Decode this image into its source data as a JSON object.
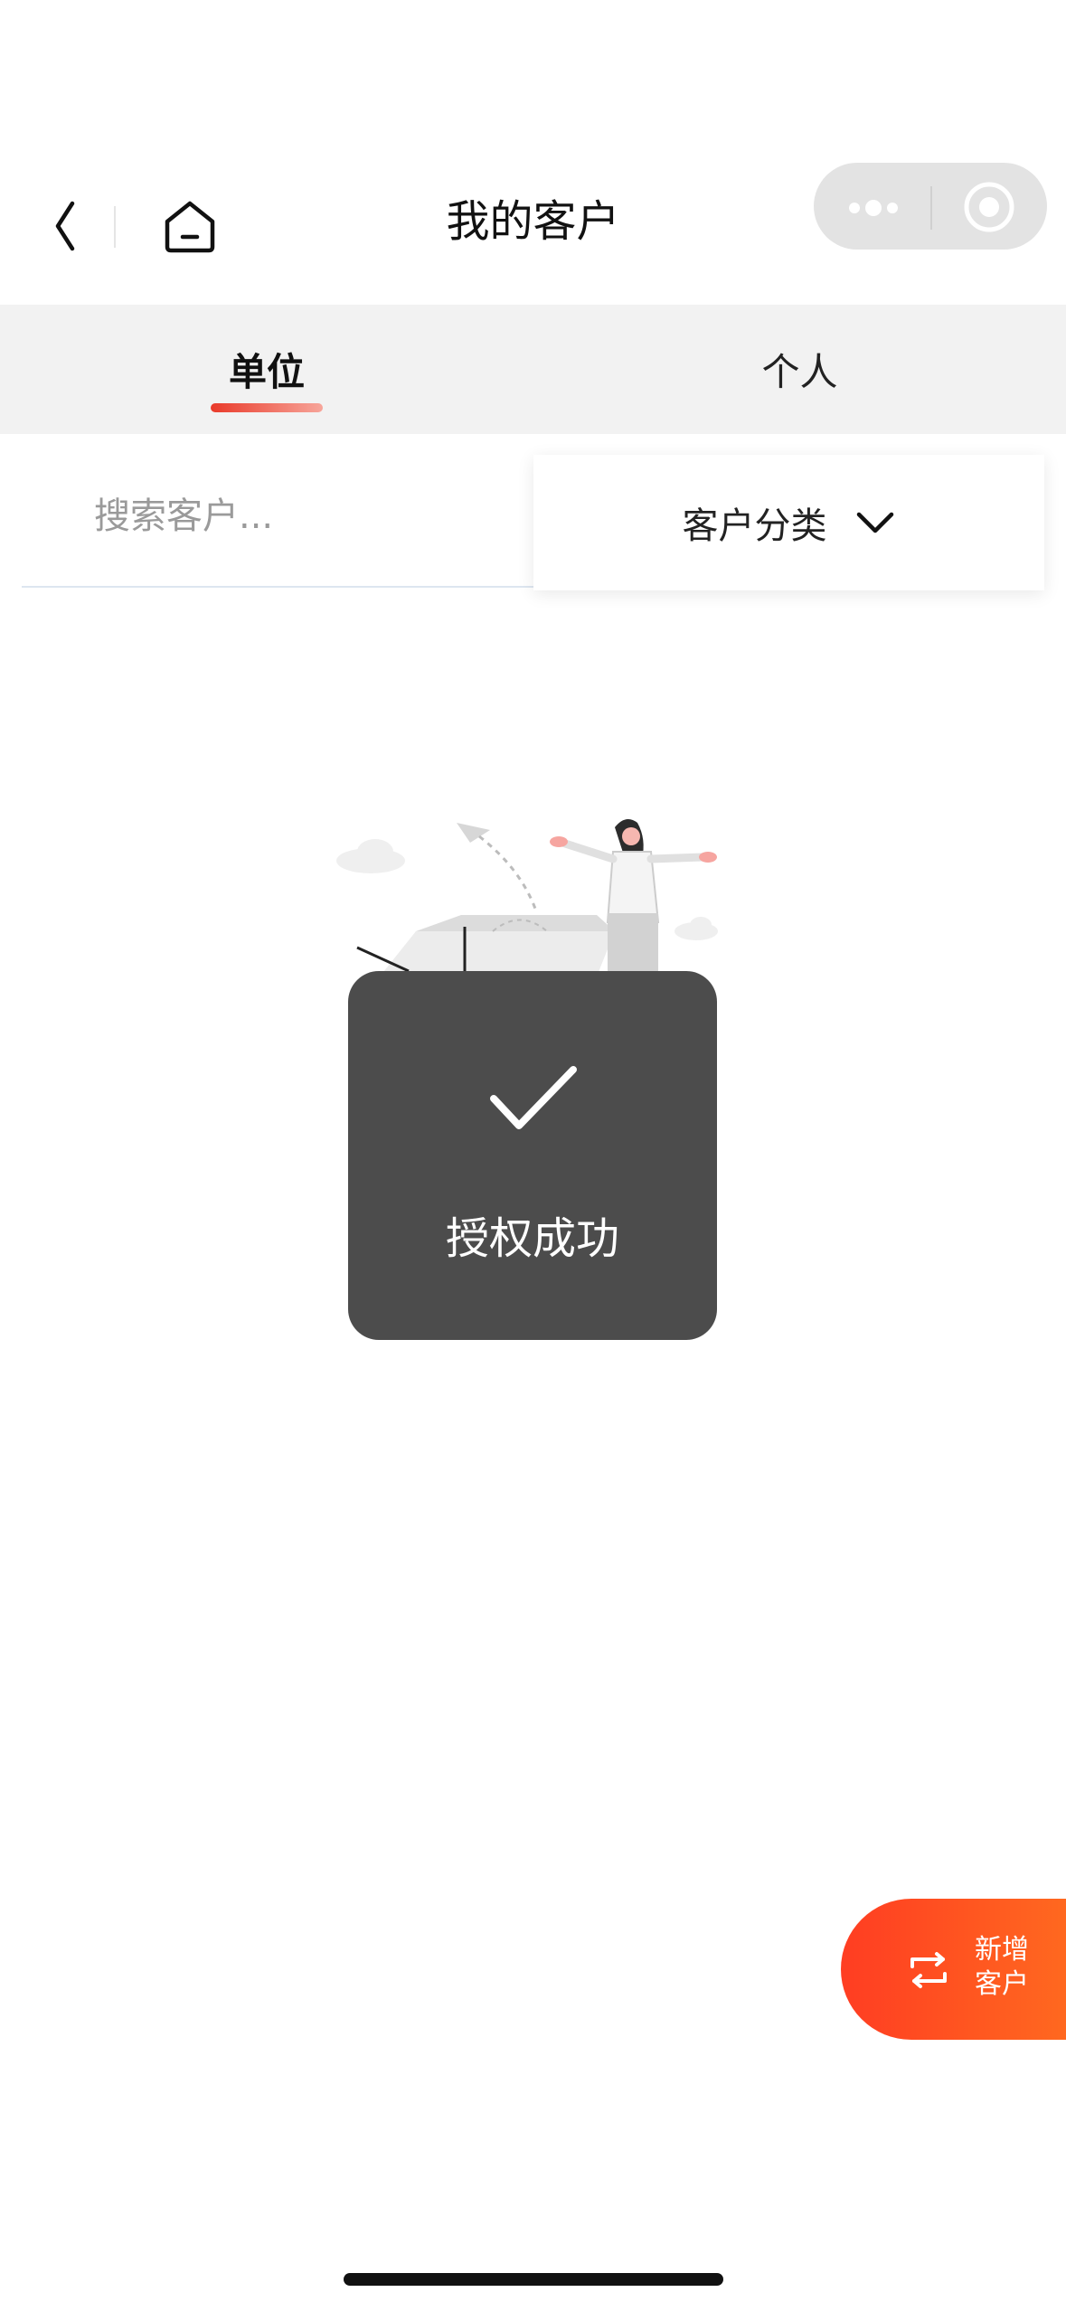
{
  "header": {
    "title": "我的客户",
    "back_icon": "chevron-left-icon",
    "home_icon": "home-icon",
    "capsule_more_icon": "more-dots-icon",
    "capsule_close_icon": "target-close-icon"
  },
  "tabs": [
    {
      "label": "单位",
      "active": true
    },
    {
      "label": "个人",
      "active": false
    }
  ],
  "search": {
    "placeholder": "搜索客户...",
    "value": ""
  },
  "filter": {
    "label": "客户分类",
    "icon": "chevron-down-icon"
  },
  "empty_state": {
    "illustration": "woman-with-open-box-illustration"
  },
  "toast": {
    "icon": "check-icon",
    "message": "授权成功"
  },
  "fab": {
    "icon": "swap-arrows-icon",
    "line1": "新增",
    "line2": "客户"
  },
  "colors": {
    "accent": "#e93a2a",
    "fab_start": "#ff3d22",
    "fab_end": "#ff6a1f",
    "toast_bg": "#4c4c4c",
    "tab_bg": "#f2f2f2"
  }
}
